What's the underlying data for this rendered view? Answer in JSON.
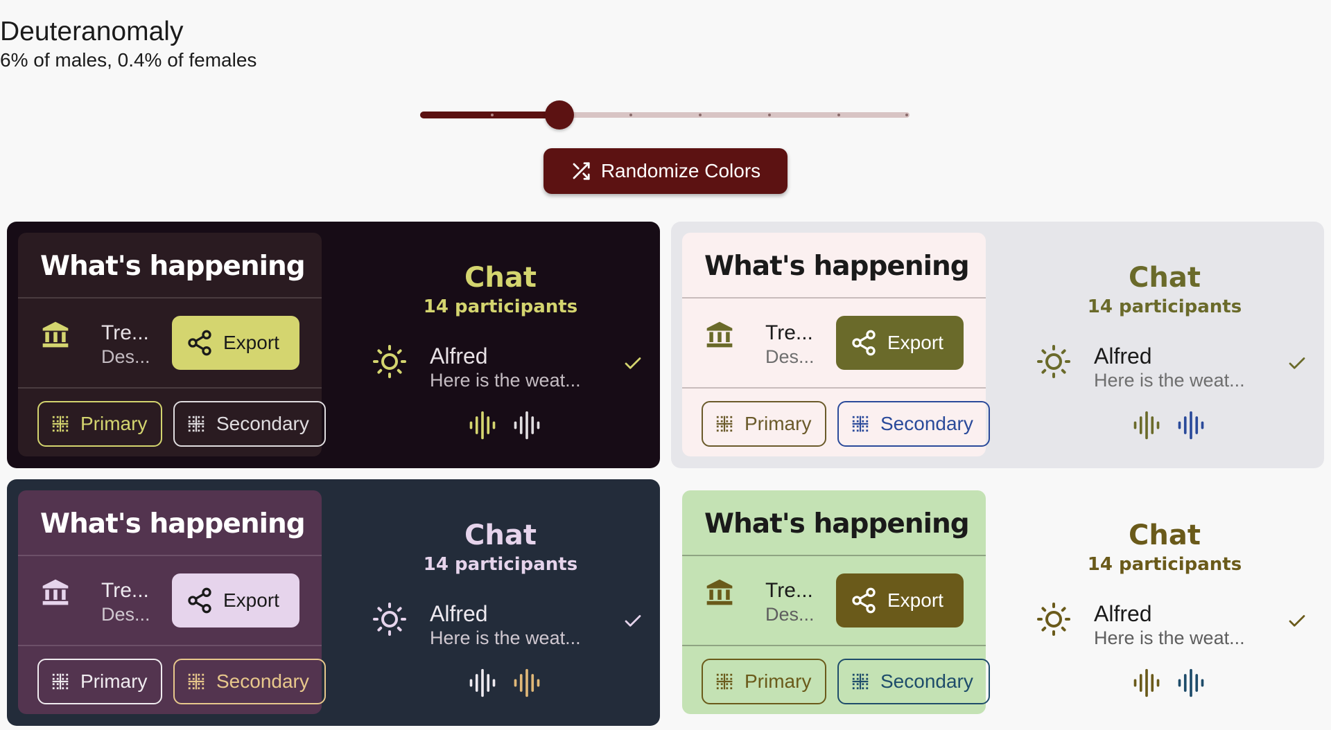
{
  "header": {
    "title": "Deuteranomaly",
    "subtitle": "6% of males, 0.4% of females"
  },
  "slider": {
    "value_index": 2,
    "steps": 8
  },
  "randomize_button": {
    "label": "Randomize Colors"
  },
  "panels": [
    {
      "card": {
        "title": "What's happening",
        "item_title": "Tre...",
        "item_desc": "Des...",
        "export_label": "Export",
        "primary_label": "Primary",
        "secondary_label": "Secondary"
      },
      "chat": {
        "title": "Chat",
        "participants": "14 participants",
        "name": "Alfred",
        "message": "Here is the weat..."
      },
      "colors": {
        "bg": "#170c16",
        "card": "#2a1b21",
        "title": "#ffffff",
        "accent": "#d4d56f",
        "accent_text": "#1a1a1a",
        "text": "#e8e2e6",
        "muted": "#c4bcc2",
        "divider": "#4a3c40",
        "primary": "#d4d56f",
        "secondary": "#e0dde0",
        "wave1": "#d4d56f",
        "wave2": "#e0dde0"
      }
    },
    {
      "card": {
        "title": "What's happening",
        "item_title": "Tre...",
        "item_desc": "Des...",
        "export_label": "Export",
        "primary_label": "Primary",
        "secondary_label": "Secondary"
      },
      "chat": {
        "title": "Chat",
        "participants": "14 participants",
        "name": "Alfred",
        "message": "Here is the weat..."
      },
      "colors": {
        "bg": "#e6e6ea",
        "card": "#fbf0f0",
        "title": "#1a1a1a",
        "accent": "#6a6a2a",
        "accent_text": "#ffffff",
        "text": "#1a1a1a",
        "muted": "#6e6e6e",
        "divider": "#c8bcbc",
        "primary": "#6a5a2a",
        "secondary": "#2a4a9a",
        "wave1": "#6a6a2a",
        "wave2": "#2a4a9a"
      }
    },
    {
      "card": {
        "title": "What's happening",
        "item_title": "Tre...",
        "item_desc": "Des...",
        "export_label": "Export",
        "primary_label": "Primary",
        "secondary_label": "Secondary"
      },
      "chat": {
        "title": "Chat",
        "participants": "14 participants",
        "name": "Alfred",
        "message": "Here is the weat..."
      },
      "colors": {
        "bg": "#232c3a",
        "card": "#53344f",
        "title": "#ffffff",
        "accent": "#e6d4ec",
        "accent_text": "#1a1a1a",
        "text": "#eeeaf0",
        "muted": "#d0c8d0",
        "divider": "#6c5068",
        "primary": "#f0ecf0",
        "secondary": "#e8c88c",
        "wave1": "#eeeaf0",
        "wave2": "#e0b878"
      }
    },
    {
      "card": {
        "title": "What's happening",
        "item_title": "Tre...",
        "item_desc": "Des...",
        "export_label": "Export",
        "primary_label": "Primary",
        "secondary_label": "Secondary"
      },
      "chat": {
        "title": "Chat",
        "participants": "14 participants",
        "name": "Alfred",
        "message": "Here is the weat..."
      },
      "colors": {
        "bg": "#f8f8f8",
        "card": "#c4e2b4",
        "title": "#1a1a1a",
        "accent": "#6a5a1a",
        "accent_text": "#ffffff",
        "text": "#1a1a1a",
        "muted": "#5e5e5e",
        "divider": "#8ea482",
        "primary": "#6a5a1a",
        "secondary": "#1e4c6a",
        "wave1": "#6a5a1a",
        "wave2": "#1e4c6a"
      }
    }
  ]
}
